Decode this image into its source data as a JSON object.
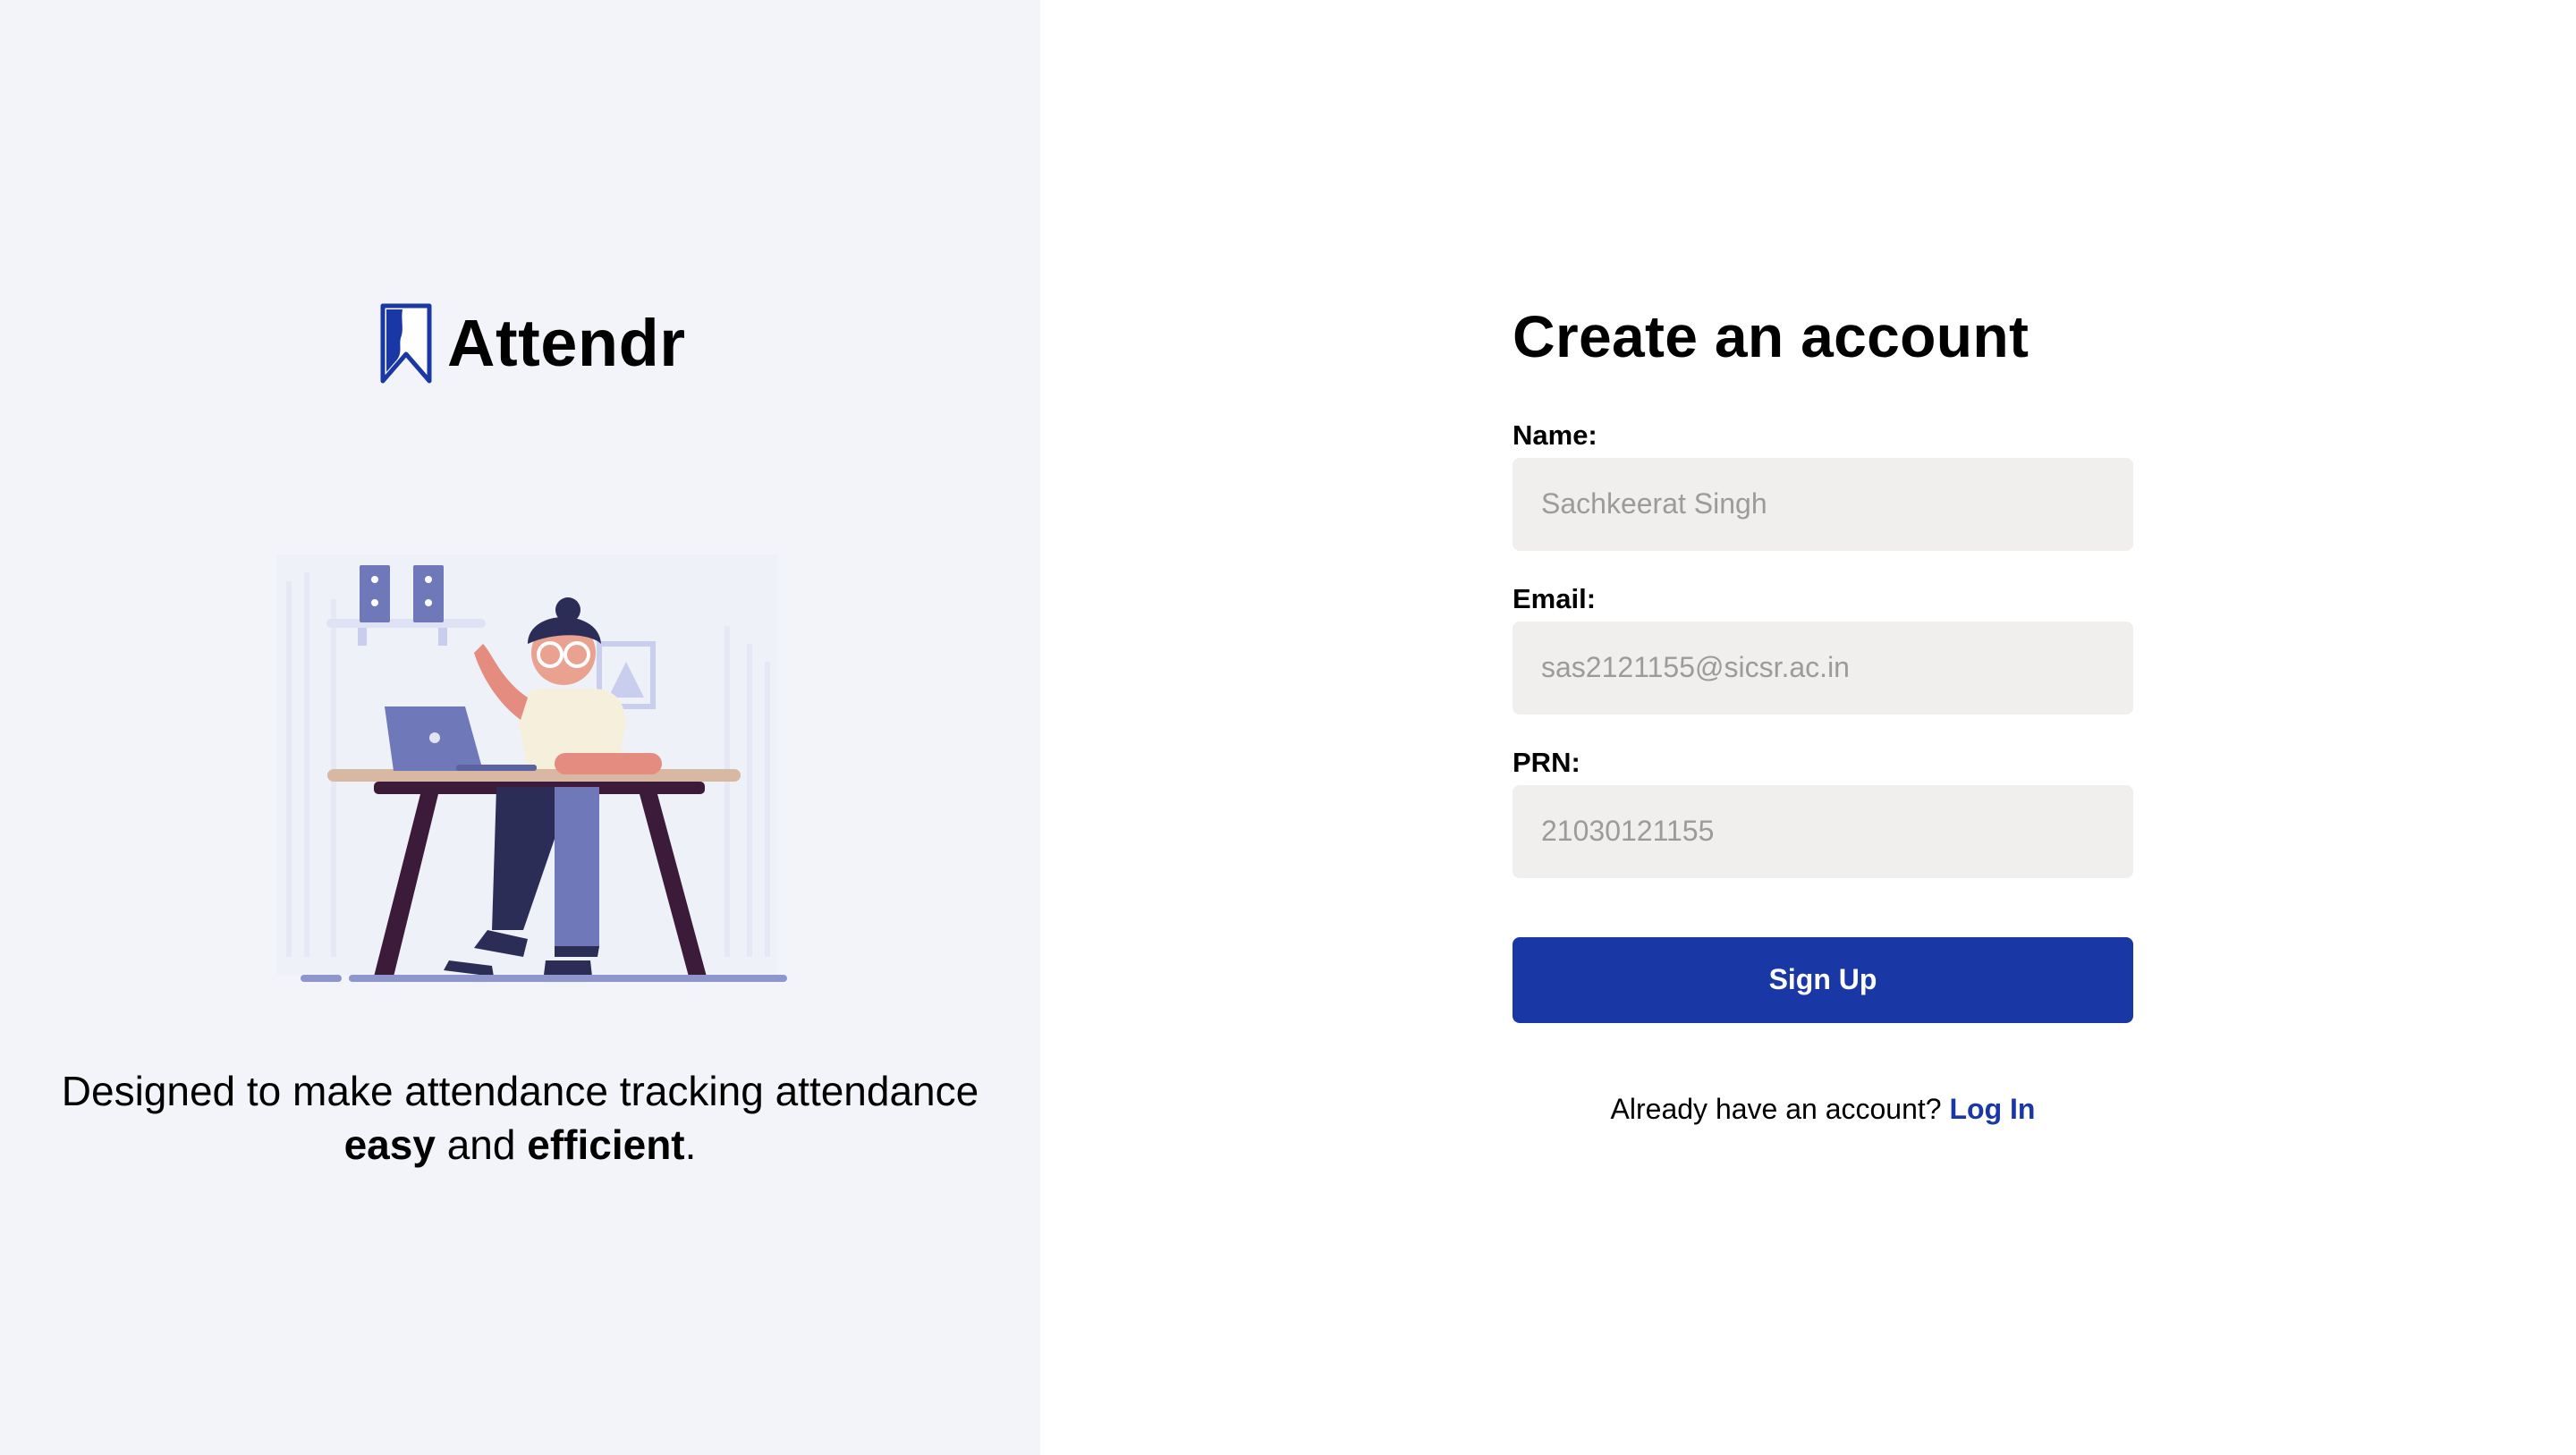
{
  "brand": {
    "name": "Attendr",
    "icon": "bookmark-logo-icon",
    "color": "#1a37a6"
  },
  "illustration": {
    "subject": "person-at-laptop-illustration"
  },
  "tagline": {
    "part1": "Designed to make attendance tracking attendance ",
    "bold1": "easy",
    "part2": " and ",
    "bold2": "efficient",
    "part3": "."
  },
  "form": {
    "title": "Create an account",
    "name": {
      "label": "Name:",
      "placeholder": "Sachkeerat Singh"
    },
    "email": {
      "label": "Email:",
      "placeholder": "sas2121155@sicsr.ac.in"
    },
    "prn": {
      "label": "PRN:",
      "placeholder": "21030121155"
    },
    "submit_label": "Sign Up",
    "login_prompt": "Already have an account?",
    "login_link": "Log In"
  },
  "colors": {
    "accent": "#1a37a6",
    "left_panel_bg": "#f3f4f9",
    "input_bg": "#f1eeee"
  }
}
